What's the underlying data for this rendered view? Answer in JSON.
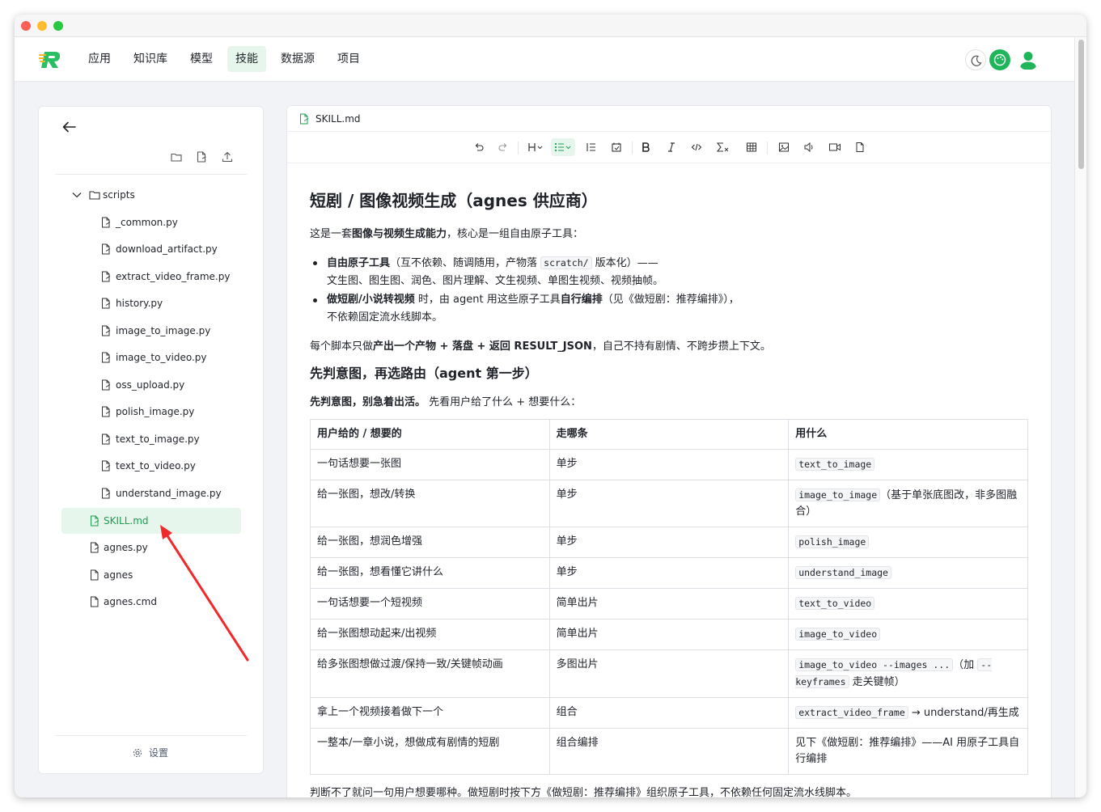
{
  "nav": {
    "items": [
      {
        "label": "应用"
      },
      {
        "label": "知识库"
      },
      {
        "label": "模型"
      },
      {
        "label": "技能",
        "active": true
      },
      {
        "label": "数据源"
      },
      {
        "label": "项目"
      }
    ],
    "icons": [
      "moon-icon",
      "palette-icon",
      "user-icon"
    ],
    "accent_color": "#1fb55b"
  },
  "sidebar": {
    "tree": [
      {
        "label": "scripts",
        "type": "folder",
        "expanded": true
      },
      {
        "label": "_common.py",
        "type": "file"
      },
      {
        "label": "download_artifact.py",
        "type": "file"
      },
      {
        "label": "extract_video_frame.py",
        "type": "file"
      },
      {
        "label": "history.py",
        "type": "file"
      },
      {
        "label": "image_to_image.py",
        "type": "file"
      },
      {
        "label": "image_to_video.py",
        "type": "file"
      },
      {
        "label": "oss_upload.py",
        "type": "file"
      },
      {
        "label": "polish_image.py",
        "type": "file"
      },
      {
        "label": "text_to_image.py",
        "type": "file"
      },
      {
        "label": "text_to_video.py",
        "type": "file"
      },
      {
        "label": "understand_image.py",
        "type": "file"
      },
      {
        "label": "SKILL.md",
        "type": "file",
        "selected": true
      },
      {
        "label": "agnes.py",
        "type": "file"
      },
      {
        "label": "agnes",
        "type": "file"
      },
      {
        "label": "agnes.cmd",
        "type": "file"
      }
    ],
    "settings_label": "设置"
  },
  "editor": {
    "filename": "SKILL.md",
    "heading1": "短剧 / 图像视频生成（agnes 供应商）",
    "intro": {
      "pre": "这是一套",
      "bold": "图像与视频生成能力",
      "post": "，核心是一组自由原子工具："
    },
    "bullet1": {
      "bold": "自由原子工具",
      "text_a": "（互不依赖、随调随用，产物落 ",
      "code": "scratch/",
      "text_b": " 版本化）——",
      "line2": "文生图、图生图、润色、图片理解、文生视频、单图生视频、视频抽帧。"
    },
    "bullet2": {
      "bold": "做短剧/小说转视频",
      "text_a": " 时，由 agent 用这些原子工具",
      "bold2": "自行编排",
      "text_b": "（见《做短剧：推荐编排》），",
      "line2": "不依赖固定流水线脚本。"
    },
    "para2": {
      "pre": "每个脚本只做",
      "bold": "产出一个产物 + 落盘 + 返回 RESULT_JSON",
      "post": "，自己不持有剧情、不跨步攒上下文。"
    },
    "heading2": "先判意图，再选路由（agent 第一步）",
    "para3": {
      "bold": "先判意图，别急着出活。",
      "post": " 先看用户给了什么 + 想要什么："
    },
    "table": {
      "headers": [
        "用户给的 / 想要的",
        "走哪条",
        "用什么"
      ],
      "rows": [
        {
          "c1": "一句话想要一张图",
          "c2": "单步",
          "c3_code": "text_to_image",
          "c3_text": ""
        },
        {
          "c1": "给一张图，想改/转换",
          "c2": "单步",
          "c3_code": "image_to_image",
          "c3_text": "（基于单张底图改，非多图融合）"
        },
        {
          "c1": "给一张图，想润色增强",
          "c2": "单步",
          "c3_code": "polish_image",
          "c3_text": ""
        },
        {
          "c1": "给一张图，想看懂它讲什么",
          "c2": "单步",
          "c3_code": "understand_image",
          "c3_text": ""
        },
        {
          "c1": "一句话想要一个短视频",
          "c2": "简单出片",
          "c3_code": "text_to_video",
          "c3_text": ""
        },
        {
          "c1": "给一张图想动起来/出视频",
          "c2": "简单出片",
          "c3_code": "image_to_video",
          "c3_text": ""
        },
        {
          "c1": "给多张图想做过渡/保持一致/关键帧动画",
          "c2": "多图出片",
          "c3_code": "image_to_video --images ...",
          "c3_text": "（加 ",
          "c3_code2": "--keyframes",
          "c3_text2": " 走关键帧）"
        },
        {
          "c1": "拿上一个视频接着做下一个",
          "c2": "组合",
          "c3_code": "extract_video_frame",
          "c3_text": " → understand/再生成"
        },
        {
          "c1": "一整本/一章小说，想做成有剧情的短剧",
          "c2": "组合编排",
          "c3_code": "",
          "c3_text": "见下《做短剧：推荐编排》——AI 用原子工具自行编排"
        }
      ]
    },
    "tail": "判断不了就问一句用户想要哪种。做短剧时按下方《做短剧：推荐编排》组织原子工具，不依赖任何固定流水线脚本。"
  }
}
